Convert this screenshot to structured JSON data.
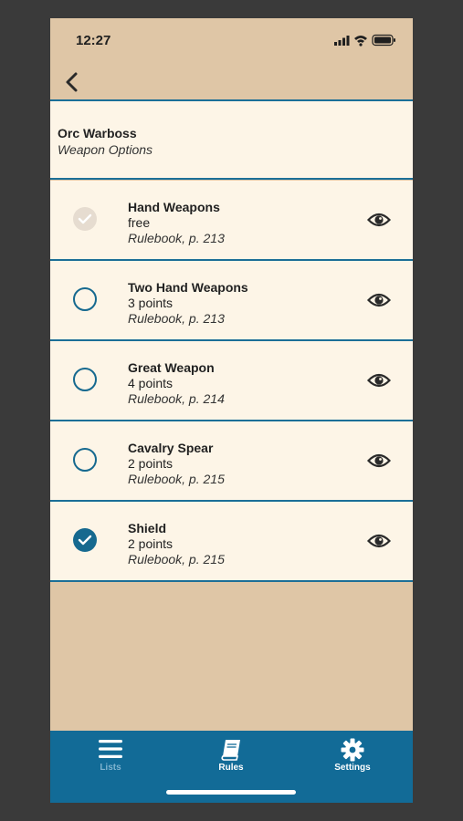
{
  "status_bar": {
    "time": "12:27"
  },
  "header": {
    "unit_name": "Orc Warboss",
    "subtitle": "Weapon Options"
  },
  "options": [
    {
      "name": "Hand Weapons",
      "cost": "free",
      "reference": "Rulebook, p. 213",
      "state": "disabled-checked"
    },
    {
      "name": "Two Hand Weapons",
      "cost": "3 points",
      "reference": "Rulebook, p. 213",
      "state": "unchecked"
    },
    {
      "name": "Great Weapon",
      "cost": "4 points",
      "reference": "Rulebook, p. 214",
      "state": "unchecked"
    },
    {
      "name": "Cavalry Spear",
      "cost": "2 points",
      "reference": "Rulebook, p. 215",
      "state": "unchecked"
    },
    {
      "name": "Shield",
      "cost": "2 points",
      "reference": "Rulebook, p. 215",
      "state": "checked"
    }
  ],
  "tab_bar": {
    "tabs": [
      {
        "label": "Lists",
        "icon": "list-icon",
        "selected": false
      },
      {
        "label": "Rules",
        "icon": "book-icon",
        "selected": true
      },
      {
        "label": "Settings",
        "icon": "gear-icon",
        "selected": true
      }
    ]
  },
  "colors": {
    "accent": "#16698f",
    "background": "#dfc6a6",
    "card": "#fdf5e7",
    "tab_bar": "#126b97"
  }
}
